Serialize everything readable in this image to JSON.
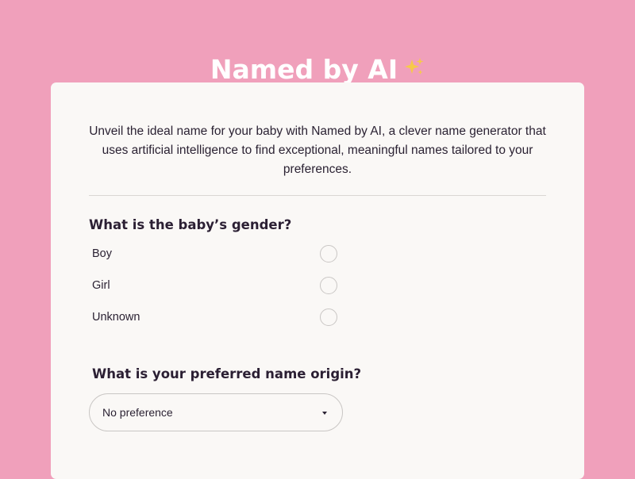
{
  "header": {
    "title": "Named by AI",
    "title_icon": "sparkles-icon",
    "title_color": "#ffffff",
    "background_color": "#f0a0bb"
  },
  "card": {
    "background_color": "#faf8f6",
    "intro": "Unveil the ideal name for your baby with Named by AI, a clever name generator that uses artificial intelligence to find exceptional, meaningful names tailored to your preferences."
  },
  "gender": {
    "question": "What is the baby’s gender?",
    "options": [
      {
        "label": "Boy",
        "selected": false
      },
      {
        "label": "Girl",
        "selected": false
      },
      {
        "label": "Unknown",
        "selected": false
      }
    ]
  },
  "origin": {
    "question": "What is your preferred name origin?",
    "selected": "No preference",
    "icon": "chevron-down-icon"
  }
}
